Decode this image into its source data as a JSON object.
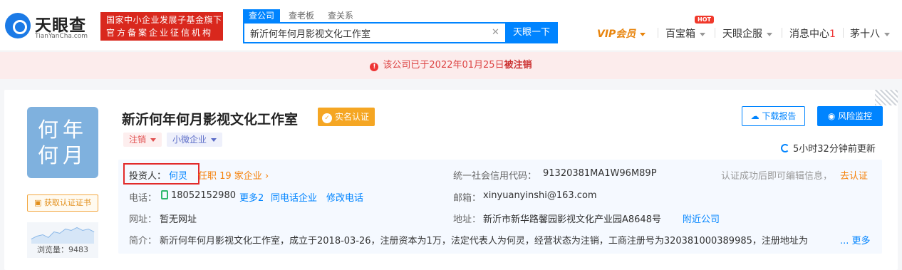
{
  "header": {
    "logo_cn": "天眼查",
    "logo_en": "TianYanCha.com",
    "badge_line1": "国家中小企业发展子基金旗下",
    "badge_line2": "官方备案企业征信机构",
    "tabs": [
      "查公司",
      "查老板",
      "查关系"
    ],
    "search_value": "新沂何年何月影视文化工作室",
    "search_button": "天眼一下",
    "nav": {
      "vip": "VIP会员",
      "baobao": "百宝箱",
      "hot": "HOT",
      "qifu": "天眼企服",
      "msg": "消息中心",
      "msg_count": "1",
      "user": "茅十八"
    }
  },
  "banner": {
    "text": "该公司已于2022年01月25日",
    "status": "被注销",
    "icon": "!"
  },
  "company": {
    "avatar_line1": "何年",
    "avatar_line2": "何月",
    "cert_button": "获取认证证书",
    "views_label": "浏览量：9483",
    "name": "新沂何年何月影视文化工作室",
    "verified": "实名认证",
    "tags": [
      "注销",
      "小微企业"
    ],
    "download_button": "下载报告",
    "monitor_button": "风险监控",
    "updated": "5小时32分钟前更新"
  },
  "info": {
    "investor_label": "投资人：",
    "investor_name": "何灵",
    "investor_roles": "任职 19 家企业",
    "credit_label": "统一社会信用代码：",
    "credit_code": "91320381MA1W96M89P",
    "edit_hint": "认证成功后即可编辑信息，",
    "edit_link": "去认证",
    "phone_label": "电话：",
    "phone": "18052152980",
    "more_phone": "更多2",
    "same_phone": "同电话企业",
    "edit_phone": "修改电话",
    "email_label": "邮箱：",
    "email": "xinyuanyinshi@163.com",
    "site_label": "网址：",
    "site": "暂无网址",
    "addr_label": "地址：",
    "addr": "新沂市新华路馨园影视文化产业园A8648号",
    "nearby": "附近公司",
    "intro_label": "简介：",
    "intro": "新沂何年何月影视文化工作室，成立于2018-03-26，注册资本为1万，法定代表人为何灵，经营状态为注销，工商注册号为320381000389985，注册地址为",
    "more": "... 更多"
  },
  "colors": {
    "brand": "#0084ff",
    "alert": "#d9281d",
    "orange": "#f5820c"
  }
}
